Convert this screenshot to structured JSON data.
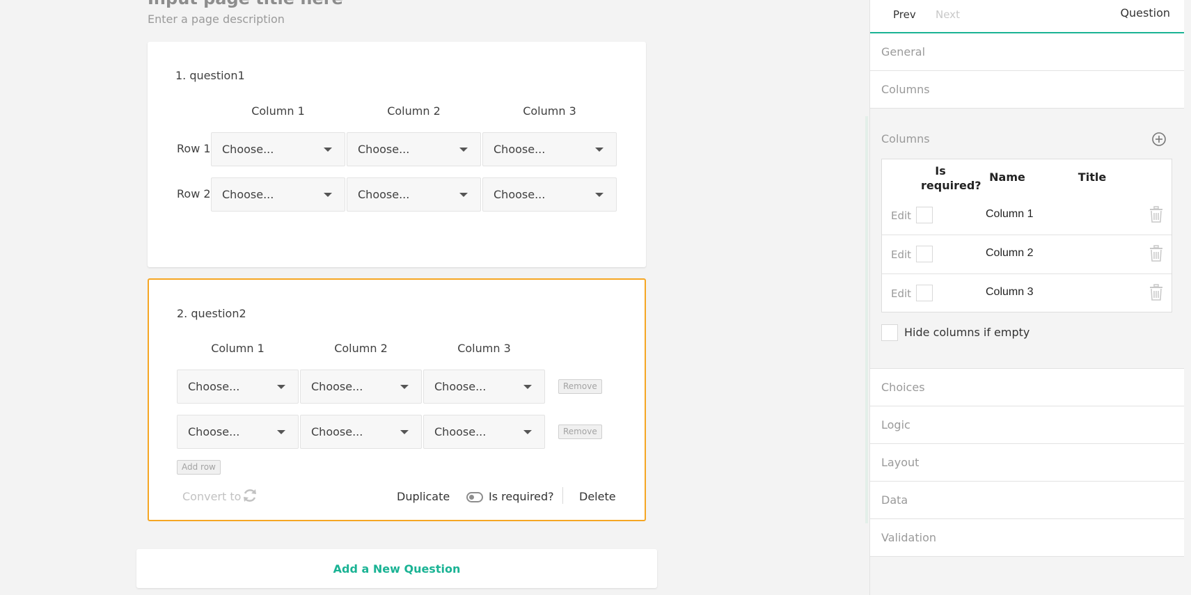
{
  "page": {
    "title": "Input page title here",
    "description": "Enter a page description"
  },
  "question1": {
    "title": "1. question1",
    "columns": [
      "Column 1",
      "Column 2",
      "Column 3"
    ],
    "rows": [
      {
        "label": "Row 1",
        "cells": [
          "Choose...",
          "Choose...",
          "Choose..."
        ]
      },
      {
        "label": "Row 2",
        "cells": [
          "Choose...",
          "Choose...",
          "Choose..."
        ]
      }
    ]
  },
  "question2": {
    "title": "2. question2",
    "columns": [
      "Column 1",
      "Column 2",
      "Column 3"
    ],
    "rows": [
      {
        "cells": [
          "Choose...",
          "Choose...",
          "Choose..."
        ],
        "remove_label": "Remove"
      },
      {
        "cells": [
          "Choose...",
          "Choose...",
          "Choose..."
        ],
        "remove_label": "Remove"
      }
    ],
    "add_row_label": "Add row",
    "footer": {
      "convert_label": "Convert to",
      "duplicate_label": "Duplicate",
      "is_required_label": "Is required?",
      "delete_label": "Delete"
    }
  },
  "add_question_label": "Add a New Question",
  "panel": {
    "prev_label": "Prev",
    "next_label": "Next",
    "object_label": "Question",
    "sections_top": [
      "General",
      "Columns"
    ],
    "columns_editor": {
      "title": "Columns",
      "headers": {
        "required": "Is required?",
        "name": "Name",
        "title": "Title"
      },
      "rows": [
        {
          "edit": "Edit",
          "name": "Column 1",
          "required": false
        },
        {
          "edit": "Edit",
          "name": "Column 2",
          "required": false
        },
        {
          "edit": "Edit",
          "name": "Column 3",
          "required": false
        }
      ],
      "hide_columns_label": "Hide columns if empty"
    },
    "sections_bottom": [
      "Choices",
      "Logic",
      "Layout",
      "Data",
      "Validation"
    ]
  },
  "colors": {
    "accent": "#1ab394",
    "selected_border": "#f5a623"
  }
}
